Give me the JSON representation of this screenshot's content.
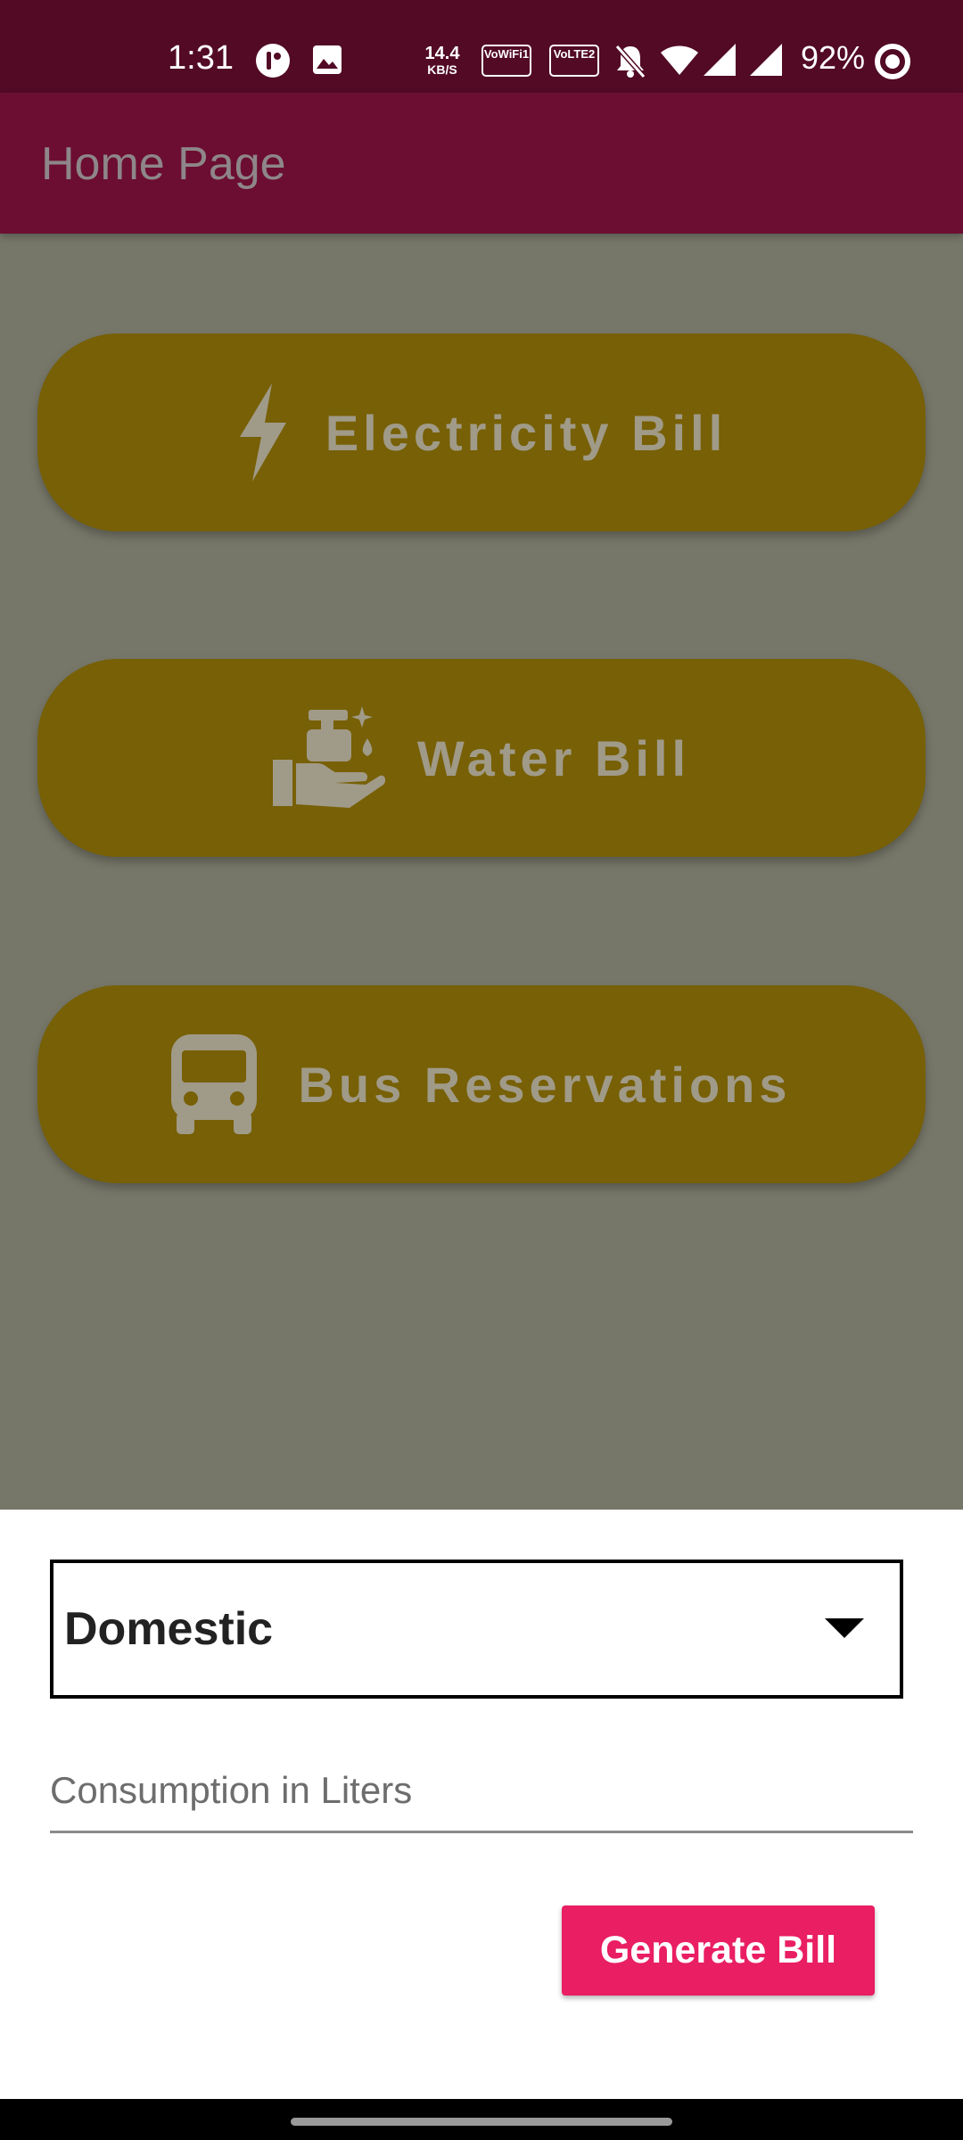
{
  "status_bar": {
    "time": "1:31",
    "net_speed_value": "14.4",
    "net_speed_unit": "KB/S",
    "vowifi_label": "VoWiFi1",
    "volte_label": "VoLTE2",
    "battery": "92%"
  },
  "app_bar": {
    "title": "Home Page"
  },
  "menu": {
    "electricity_label": "Electricity Bill",
    "water_label": "Water Bill",
    "bus_label": "Bus Reservations"
  },
  "sheet": {
    "dropdown_value": "Domestic",
    "consumption_placeholder": "Consumption in Liters",
    "generate_label": "Generate Bill"
  },
  "colors": {
    "status_bar": "#520a25",
    "app_bar": "#6c0e31",
    "menu_button": "#776005",
    "generate_button": "#e91e63"
  },
  "icons": [
    "gesture-icon",
    "image-icon",
    "bell-off-icon",
    "wifi-icon",
    "signal-icon",
    "battery-saver-icon",
    "bolt-icon",
    "hand-wash-icon",
    "bus-icon"
  ]
}
